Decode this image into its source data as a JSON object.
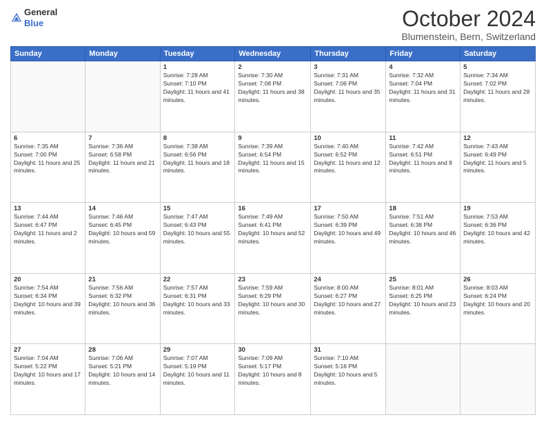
{
  "header": {
    "logo_line1": "General",
    "logo_line2": "Blue",
    "month_title": "October 2024",
    "location": "Blumenstein, Bern, Switzerland"
  },
  "weekdays": [
    "Sunday",
    "Monday",
    "Tuesday",
    "Wednesday",
    "Thursday",
    "Friday",
    "Saturday"
  ],
  "weeks": [
    [
      {
        "day": "",
        "text": ""
      },
      {
        "day": "",
        "text": ""
      },
      {
        "day": "1",
        "text": "Sunrise: 7:28 AM\nSunset: 7:10 PM\nDaylight: 11 hours and 41 minutes."
      },
      {
        "day": "2",
        "text": "Sunrise: 7:30 AM\nSunset: 7:08 PM\nDaylight: 11 hours and 38 minutes."
      },
      {
        "day": "3",
        "text": "Sunrise: 7:31 AM\nSunset: 7:06 PM\nDaylight: 11 hours and 35 minutes."
      },
      {
        "day": "4",
        "text": "Sunrise: 7:32 AM\nSunset: 7:04 PM\nDaylight: 11 hours and 31 minutes."
      },
      {
        "day": "5",
        "text": "Sunrise: 7:34 AM\nSunset: 7:02 PM\nDaylight: 11 hours and 28 minutes."
      }
    ],
    [
      {
        "day": "6",
        "text": "Sunrise: 7:35 AM\nSunset: 7:00 PM\nDaylight: 11 hours and 25 minutes."
      },
      {
        "day": "7",
        "text": "Sunrise: 7:36 AM\nSunset: 6:58 PM\nDaylight: 11 hours and 21 minutes."
      },
      {
        "day": "8",
        "text": "Sunrise: 7:38 AM\nSunset: 6:56 PM\nDaylight: 11 hours and 18 minutes."
      },
      {
        "day": "9",
        "text": "Sunrise: 7:39 AM\nSunset: 6:54 PM\nDaylight: 11 hours and 15 minutes."
      },
      {
        "day": "10",
        "text": "Sunrise: 7:40 AM\nSunset: 6:52 PM\nDaylight: 11 hours and 12 minutes."
      },
      {
        "day": "11",
        "text": "Sunrise: 7:42 AM\nSunset: 6:51 PM\nDaylight: 11 hours and 8 minutes."
      },
      {
        "day": "12",
        "text": "Sunrise: 7:43 AM\nSunset: 6:49 PM\nDaylight: 11 hours and 5 minutes."
      }
    ],
    [
      {
        "day": "13",
        "text": "Sunrise: 7:44 AM\nSunset: 6:47 PM\nDaylight: 11 hours and 2 minutes."
      },
      {
        "day": "14",
        "text": "Sunrise: 7:46 AM\nSunset: 6:45 PM\nDaylight: 10 hours and 59 minutes."
      },
      {
        "day": "15",
        "text": "Sunrise: 7:47 AM\nSunset: 6:43 PM\nDaylight: 10 hours and 55 minutes."
      },
      {
        "day": "16",
        "text": "Sunrise: 7:49 AM\nSunset: 6:41 PM\nDaylight: 10 hours and 52 minutes."
      },
      {
        "day": "17",
        "text": "Sunrise: 7:50 AM\nSunset: 6:39 PM\nDaylight: 10 hours and 49 minutes."
      },
      {
        "day": "18",
        "text": "Sunrise: 7:51 AM\nSunset: 6:38 PM\nDaylight: 10 hours and 46 minutes."
      },
      {
        "day": "19",
        "text": "Sunrise: 7:53 AM\nSunset: 6:36 PM\nDaylight: 10 hours and 42 minutes."
      }
    ],
    [
      {
        "day": "20",
        "text": "Sunrise: 7:54 AM\nSunset: 6:34 PM\nDaylight: 10 hours and 39 minutes."
      },
      {
        "day": "21",
        "text": "Sunrise: 7:56 AM\nSunset: 6:32 PM\nDaylight: 10 hours and 36 minutes."
      },
      {
        "day": "22",
        "text": "Sunrise: 7:57 AM\nSunset: 6:31 PM\nDaylight: 10 hours and 33 minutes."
      },
      {
        "day": "23",
        "text": "Sunrise: 7:59 AM\nSunset: 6:29 PM\nDaylight: 10 hours and 30 minutes."
      },
      {
        "day": "24",
        "text": "Sunrise: 8:00 AM\nSunset: 6:27 PM\nDaylight: 10 hours and 27 minutes."
      },
      {
        "day": "25",
        "text": "Sunrise: 8:01 AM\nSunset: 6:25 PM\nDaylight: 10 hours and 23 minutes."
      },
      {
        "day": "26",
        "text": "Sunrise: 8:03 AM\nSunset: 6:24 PM\nDaylight: 10 hours and 20 minutes."
      }
    ],
    [
      {
        "day": "27",
        "text": "Sunrise: 7:04 AM\nSunset: 5:22 PM\nDaylight: 10 hours and 17 minutes."
      },
      {
        "day": "28",
        "text": "Sunrise: 7:06 AM\nSunset: 5:21 PM\nDaylight: 10 hours and 14 minutes."
      },
      {
        "day": "29",
        "text": "Sunrise: 7:07 AM\nSunset: 5:19 PM\nDaylight: 10 hours and 11 minutes."
      },
      {
        "day": "30",
        "text": "Sunrise: 7:09 AM\nSunset: 5:17 PM\nDaylight: 10 hours and 8 minutes."
      },
      {
        "day": "31",
        "text": "Sunrise: 7:10 AM\nSunset: 5:16 PM\nDaylight: 10 hours and 5 minutes."
      },
      {
        "day": "",
        "text": ""
      },
      {
        "day": "",
        "text": ""
      }
    ]
  ]
}
